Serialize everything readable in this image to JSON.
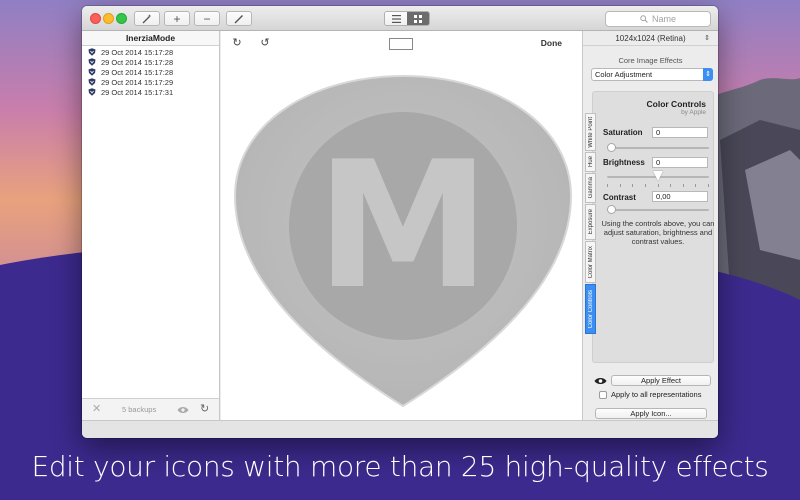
{
  "colors": {
    "accent": "#3b8ff2",
    "background_purple": "#3a2a8a",
    "close": "#fc5f57",
    "minimize": "#fdbc2e",
    "zoom": "#33c648"
  },
  "toolbar": {
    "wand_icon": "magic-wand-icon",
    "add_label": "+",
    "remove_label": "−",
    "edit_icon": "pencil-icon",
    "view_list_icon": "list-view-icon",
    "view_grid_icon": "grid-view-icon",
    "search_placeholder": "Name"
  },
  "sidebar": {
    "title": "InerziaMode",
    "backups": [
      "29 Oct 2014 15:17:28",
      "29 Oct 2014 15:17:28",
      "29 Oct 2014 15:17:28",
      "29 Oct 2014 15:17:29",
      "29 Oct 2014 15:17:31"
    ],
    "footer_count": "5 backups"
  },
  "canvas": {
    "done_label": "Done",
    "icon_letter": "M"
  },
  "inspector": {
    "size_selector": "1024x1024 (Retina)",
    "effects_label": "Core Image Effects",
    "effects_dropdown": "Color Adjustment",
    "tabs": [
      "White Point",
      "Hue",
      "Gamma",
      "Exposure",
      "Color Matrix",
      "Color Controls"
    ],
    "active_tab": "Color Controls",
    "panel_title": "Color Controls",
    "panel_subtitle": "by Apple",
    "saturation_label": "Saturation",
    "saturation_value": "0",
    "saturation_level": 0,
    "brightness_label": "Brightness",
    "brightness_value": "0",
    "brightness_level": 0.5,
    "contrast_label": "Contrast",
    "contrast_value": "0,00",
    "contrast_level": 0,
    "description": "Using the controls above, you can adjust saturation, brightness and contrast values.",
    "apply_effect_label": "Apply Effect",
    "apply_all_label": "Apply to all representations",
    "apply_all_checked": false,
    "apply_icon_label": "Apply Icon..."
  },
  "caption": "Edit your icons with more than 25 high-quality effects"
}
